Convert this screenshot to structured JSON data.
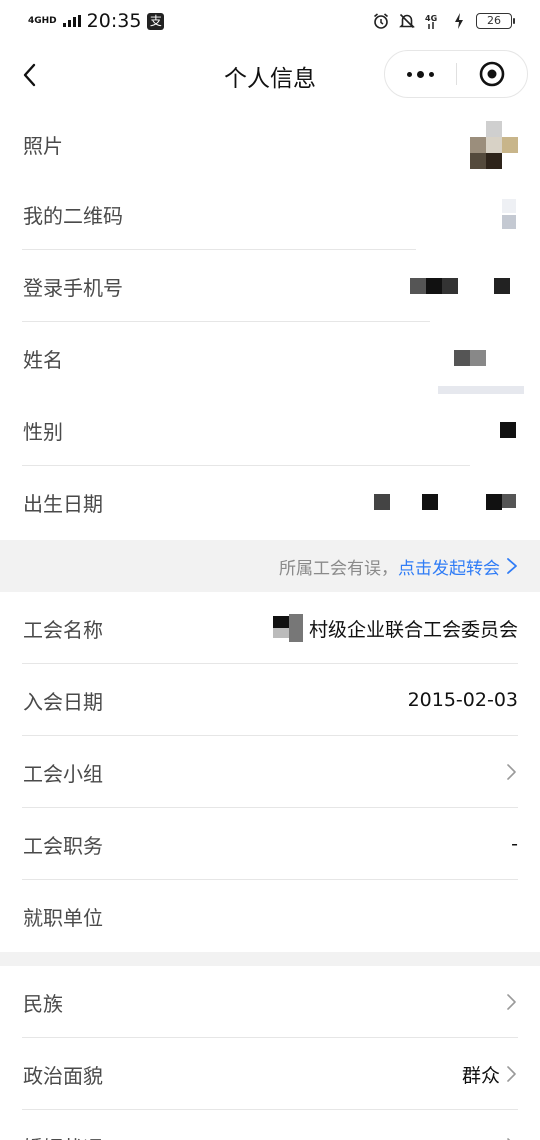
{
  "status_bar": {
    "network_label": "4GHD",
    "time": "20:35",
    "pay_icon_label": "支",
    "battery": "26",
    "icons": [
      "alarm-icon",
      "bell-off-icon",
      "4g-icon",
      "charging-icon"
    ]
  },
  "nav": {
    "title": "个人信息",
    "back_icon": "chevron-left-icon",
    "more_icon": "more-dots-icon",
    "close_icon": "target-icon"
  },
  "profile": [
    {
      "label": "照片"
    },
    {
      "label": "我的二维码"
    },
    {
      "label": "登录手机号"
    },
    {
      "label": "姓名"
    },
    {
      "label": "性别"
    },
    {
      "label": "出生日期"
    }
  ],
  "notice": {
    "text": "所属工会有误，",
    "link": "点击发起转会"
  },
  "union": [
    {
      "label": "工会名称",
      "value": "村级企业联合工会委员会"
    },
    {
      "label": "入会日期",
      "value": "2015-02-03"
    },
    {
      "label": "工会小组",
      "value": ""
    },
    {
      "label": "工会职务",
      "value": "-"
    },
    {
      "label": "就职单位",
      "value": ""
    }
  ],
  "extra": [
    {
      "label": "民族",
      "value": ""
    },
    {
      "label": "政治面貌",
      "value": "群众"
    },
    {
      "label": "婚姻状况",
      "value": ""
    }
  ],
  "colors": {
    "accent": "#2f7cf6",
    "label": "#4a4a4a",
    "section_bg": "#f2f2f2",
    "divider": "#e6e6e6"
  }
}
